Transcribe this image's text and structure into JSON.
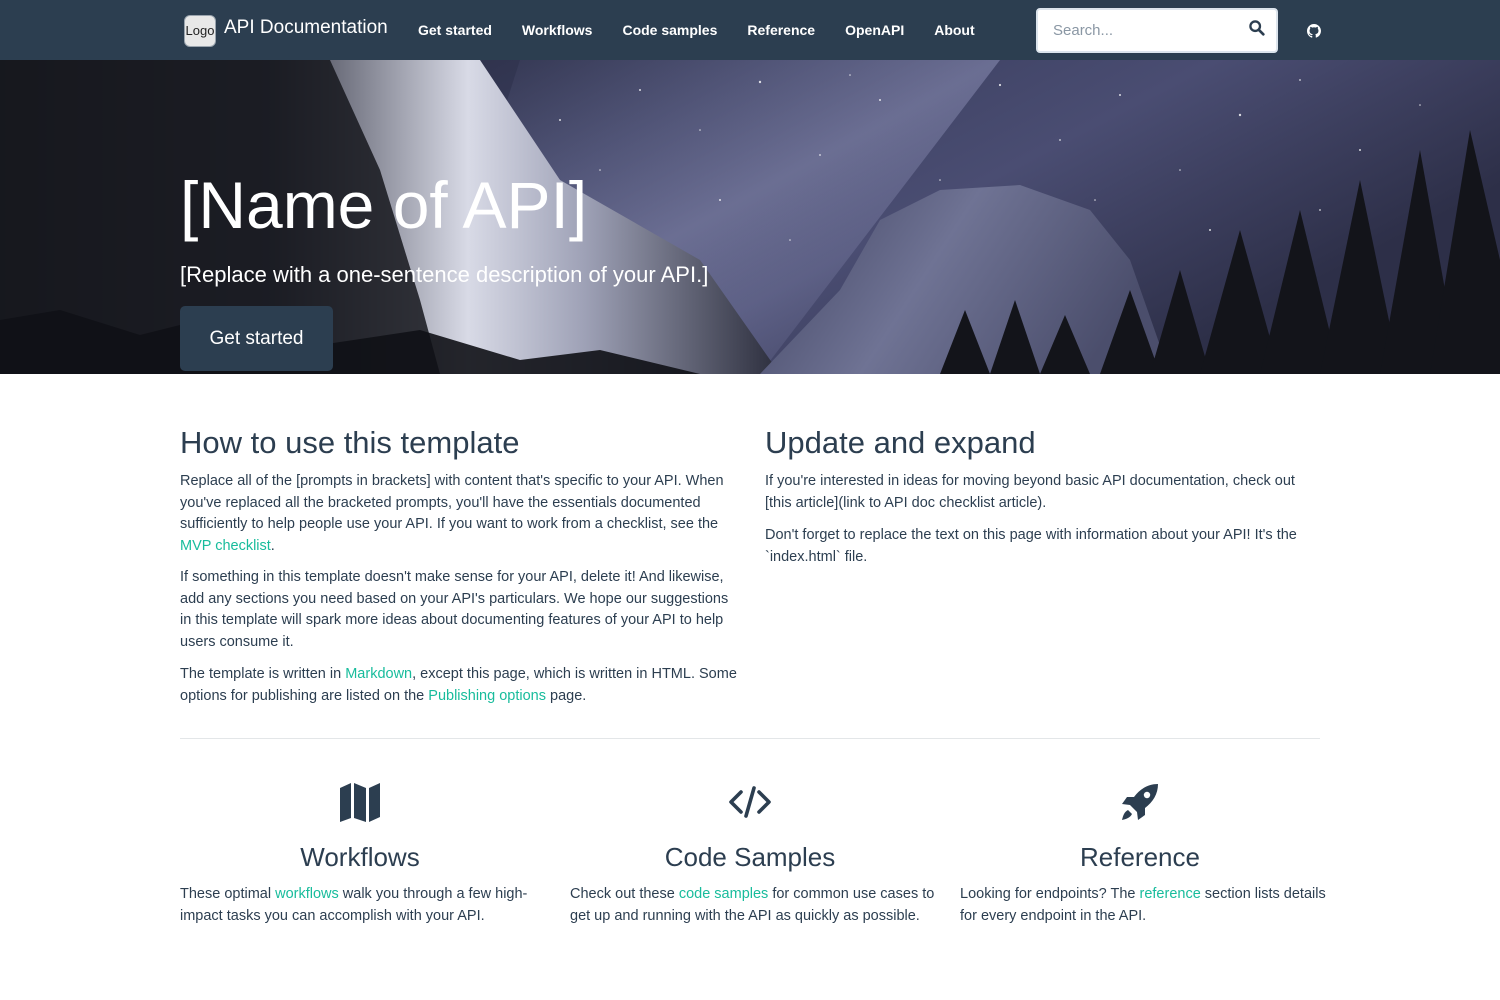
{
  "navbar": {
    "logo_text": "Logo",
    "brand_title": "API Documentation",
    "links": [
      "Get started",
      "Workflows",
      "Code samples",
      "Reference",
      "OpenAPI",
      "About"
    ],
    "search_placeholder": "Search...",
    "search_icon": "search-icon",
    "github_icon": "github-icon"
  },
  "hero": {
    "title": "[Name of API]",
    "subtitle": "[Replace with a one-sentence description of your API.]",
    "button_label": "Get started"
  },
  "how_to": {
    "heading": "How to use this template",
    "p1_text": "Replace all of the [prompts in brackets] with content that's specific to your API. When you've replaced all the bracketed prompts, you'll have the essentials documented sufficiently to help people use your API. If you want to work from a checklist, see the ",
    "p1_link": "MVP checklist",
    "p1_end": ".",
    "p2_text": "If something in this template doesn't make sense for your API, delete it! And likewise, add any sections you need based on your API's particulars. We hope our suggestions in this template will spark more ideas about documenting features of your API to help users consume it.",
    "p3_start": "The template is written in ",
    "p3_link1": "Markdown",
    "p3_mid": ", except this page, which is written in HTML. Some options for publishing are listed on the ",
    "p3_link2": "Publishing options",
    "p3_end": " page."
  },
  "update": {
    "heading": "Update and expand",
    "p1_text": "If you're interested in ideas for moving beyond basic API documentation, check out [this article](link to API doc checklist article).",
    "p2_text": "Don't forget to replace the text on this page with information about your API! It's the `index.html` file."
  },
  "features": [
    {
      "icon": "map-icon",
      "title": "Workflows",
      "text_start": "These optimal ",
      "link": "workflows",
      "text_end": " walk you through a few high-impact tasks you can accomplish with your API."
    },
    {
      "icon": "code-icon",
      "title": "Code Samples",
      "text_start": "Check out these ",
      "link": "code samples",
      "text_end": " for common use cases to get up and running with the API as quickly as possible."
    },
    {
      "icon": "rocket-icon",
      "title": "Reference",
      "text_start": "Looking for endpoints? The ",
      "link": "reference",
      "text_end": " section lists details for every endpoint in the API."
    }
  ],
  "colors": {
    "primary": "#2c3e50",
    "link": "#18bc9c",
    "hero_sky": "#2a2c45"
  }
}
